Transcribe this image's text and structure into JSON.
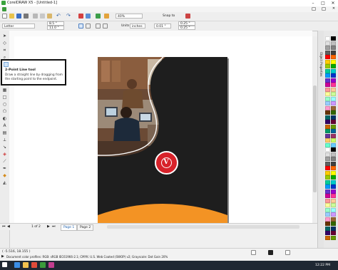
{
  "window": {
    "title": "CorelDRAW X5 - [Untitled-1]",
    "controls": [
      "–",
      "□",
      "✕"
    ]
  },
  "toolbar": {
    "zoom_value": "40%",
    "snap_label": "Snap to",
    "icons": [
      "new-icon",
      "open-icon",
      "save-icon",
      "print-icon",
      "cut-icon",
      "copy-icon",
      "paste-icon",
      "undo-icon",
      "redo-icon",
      "import-icon",
      "export-icon",
      "app-launcher-icon",
      "welcome-icon"
    ]
  },
  "property_bar": {
    "page_size": "Letter",
    "width": "8.5 \"",
    "height": "11.0 \"",
    "units_label": "Units:",
    "units_value": "inches",
    "nudge": "0.01 \"",
    "dup_x": "0.25 \"",
    "dup_y": "0.25 \""
  },
  "tooltip": {
    "title": "2-Point Line tool",
    "text": "Draw a straight line by dragging from the starting point to the endpoint."
  },
  "page_nav": {
    "counter": "1 of 2",
    "tabs": [
      "Page 1",
      "Page 2"
    ]
  },
  "status": {
    "coords": "( -5.516, 18.155 )",
    "color_profiles": "Document color profiles: RGB: sRGB IEC61966-2.1; CMYK: U.S. Web Coated (SWOP) v2; Grayscale: Dot Gain 20%"
  },
  "docker_tabs": [
    "Object Properties"
  ],
  "taskbar": {
    "time": "12:22 PM"
  },
  "colors": {
    "page_dark": "#1e1e1e",
    "orange": "#f39324",
    "logo_red": "#d7222a"
  }
}
